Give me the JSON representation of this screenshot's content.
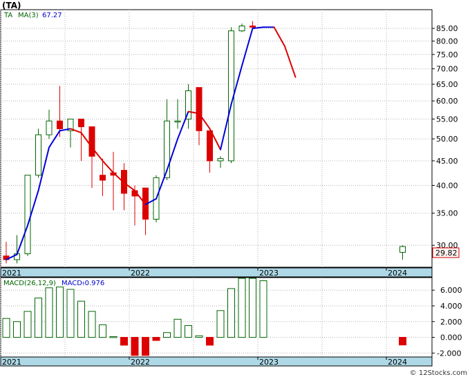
{
  "header": {
    "title": "(TA)"
  },
  "footer": {
    "credit": "© 12Stocks.com"
  },
  "colors": {
    "up": "#006400",
    "down": "#dd0000",
    "ma_up": "#0000dd",
    "ma_down": "#dd0000",
    "axis_band": "#aed8e6",
    "grid": "#b0b0b0"
  },
  "chart_data": [
    {
      "type": "candlestick",
      "scale": "log",
      "legend": {
        "symbol": "TA",
        "ma_label": "MA(3)",
        "ma_value": "67.27",
        "placement": "top-left"
      },
      "ylim": [
        27,
        93
      ],
      "y_ticks": [
        30,
        35,
        40,
        45,
        50,
        55,
        60,
        65,
        70,
        75,
        80,
        85
      ],
      "y_tick_labels": [
        "30.00",
        "35.00",
        "40.00",
        "45.00",
        "50.00",
        "55.00",
        "60.00",
        "65.00",
        "70.00",
        "75.00",
        "80.00",
        "85.00"
      ],
      "last_price": "29.82",
      "x_labels": [
        {
          "label": "2021",
          "index": 0
        },
        {
          "label": "2022",
          "index": 12
        },
        {
          "label": "2023",
          "index": 24
        },
        {
          "label": "2024",
          "index": 36
        }
      ],
      "grid": true,
      "candles": [
        {
          "o": 28.5,
          "h": 30.5,
          "l": 27.5,
          "c": 28.0
        },
        {
          "o": 28.0,
          "h": 31.5,
          "l": 27.5,
          "c": 28.8
        },
        {
          "o": 28.8,
          "h": 42.0,
          "l": 28.5,
          "c": 42.0
        },
        {
          "o": 42.0,
          "h": 52.5,
          "l": 41.5,
          "c": 51.0
        },
        {
          "o": 51.0,
          "h": 57.5,
          "l": 50.0,
          "c": 54.5
        },
        {
          "o": 54.5,
          "h": 64.5,
          "l": 50.5,
          "c": 52.5
        },
        {
          "o": 52.0,
          "h": 55.0,
          "l": 48.0,
          "c": 55.0
        },
        {
          "o": 55.0,
          "h": 55.0,
          "l": 45.0,
          "c": 53.0
        },
        {
          "o": 53.0,
          "h": 53.0,
          "l": 39.5,
          "c": 46.0
        },
        {
          "o": 42.0,
          "h": 45.5,
          "l": 38.0,
          "c": 41.0
        },
        {
          "o": 42.5,
          "h": 47.0,
          "l": 35.5,
          "c": 42.0
        },
        {
          "o": 43.0,
          "h": 44.5,
          "l": 35.5,
          "c": 38.5
        },
        {
          "o": 39.0,
          "h": 40.0,
          "l": 33.0,
          "c": 38.0
        },
        {
          "o": 39.5,
          "h": 39.5,
          "l": 31.5,
          "c": 34.0
        },
        {
          "o": 34.0,
          "h": 42.0,
          "l": 33.5,
          "c": 41.5
        },
        {
          "o": 41.5,
          "h": 60.5,
          "l": 41.0,
          "c": 54.5
        },
        {
          "o": 54.5,
          "h": 60.5,
          "l": 52.5,
          "c": 54.5
        },
        {
          "o": 55.0,
          "h": 65.0,
          "l": 52.5,
          "c": 63.0
        },
        {
          "o": 64.0,
          "h": 64.0,
          "l": 48.5,
          "c": 52.0
        },
        {
          "o": 52.0,
          "h": 52.0,
          "l": 42.5,
          "c": 45.0
        },
        {
          "o": 45.0,
          "h": 46.0,
          "l": 43.5,
          "c": 45.5
        },
        {
          "o": 45.0,
          "h": 85.5,
          "l": 44.5,
          "c": 84.0
        },
        {
          "o": 84.0,
          "h": 87.0,
          "l": 83.5,
          "c": 86.0
        },
        {
          "o": 86.0,
          "h": 88.0,
          "l": 84.5,
          "c": 85.5
        },
        {
          "o": 29.0,
          "h": 30.0,
          "l": 28.0,
          "c": 29.82
        }
      ],
      "candle_x": [
        0,
        1,
        2,
        3,
        4,
        5,
        6,
        7,
        8,
        9,
        10,
        11,
        12,
        13,
        14,
        15,
        16,
        17,
        18,
        19,
        20,
        21,
        22,
        23,
        37
      ],
      "ma": [
        {
          "x": 0,
          "v": 28.0
        },
        {
          "x": 1,
          "v": 28.7
        },
        {
          "x": 2,
          "v": 33.0
        },
        {
          "x": 3,
          "v": 39.0
        },
        {
          "x": 4,
          "v": 48.0
        },
        {
          "x": 5,
          "v": 52.0
        },
        {
          "x": 6,
          "v": 52.5
        },
        {
          "x": 7,
          "v": 51.5
        },
        {
          "x": 8,
          "v": 48.0
        },
        {
          "x": 9,
          "v": 45.0
        },
        {
          "x": 10,
          "v": 42.5
        },
        {
          "x": 11,
          "v": 40.5
        },
        {
          "x": 12,
          "v": 39.0
        },
        {
          "x": 13,
          "v": 36.5
        },
        {
          "x": 14,
          "v": 37.5
        },
        {
          "x": 15,
          "v": 43.0
        },
        {
          "x": 16,
          "v": 50.0
        },
        {
          "x": 17,
          "v": 57.0
        },
        {
          "x": 18,
          "v": 56.5
        },
        {
          "x": 19,
          "v": 52.5
        },
        {
          "x": 20,
          "v": 47.5
        },
        {
          "x": 21,
          "v": 59.0
        },
        {
          "x": 22,
          "v": 71.0
        },
        {
          "x": 23,
          "v": 85.0
        },
        {
          "x": 24,
          "v": 85.5
        },
        {
          "x": 25,
          "v": 85.5
        },
        {
          "x": 26,
          "v": 78.0
        },
        {
          "x": 27,
          "v": 67.27
        }
      ]
    },
    {
      "type": "bar",
      "legend": {
        "label": "MACD(26,12,9)",
        "value_label": "MACD:",
        "value": "-0.976",
        "placement": "top-left"
      },
      "ylim": [
        -2.5,
        7.6
      ],
      "y_ticks": [
        -2,
        0,
        2,
        4,
        6
      ],
      "y_tick_labels": [
        "-2.000",
        "0.000",
        "2.000",
        "4.000",
        "6.000"
      ],
      "x_labels": [
        {
          "label": "2021",
          "index": 0
        },
        {
          "label": "2022",
          "index": 12
        },
        {
          "label": "2023",
          "index": 24
        },
        {
          "label": "2024",
          "index": 36
        }
      ],
      "grid": true,
      "bars": [
        {
          "x": 0,
          "v": 2.4
        },
        {
          "x": 1,
          "v": 2.0
        },
        {
          "x": 2,
          "v": 3.3
        },
        {
          "x": 3,
          "v": 5.0
        },
        {
          "x": 4,
          "v": 6.3
        },
        {
          "x": 5,
          "v": 6.4
        },
        {
          "x": 6,
          "v": 6.1
        },
        {
          "x": 7,
          "v": 4.6
        },
        {
          "x": 8,
          "v": 3.3
        },
        {
          "x": 9,
          "v": 1.6
        },
        {
          "x": 10,
          "v": 0.1
        },
        {
          "x": 11,
          "v": -1.0
        },
        {
          "x": 12,
          "v": -2.3
        },
        {
          "x": 13,
          "v": -2.3
        },
        {
          "x": 14,
          "v": -0.4
        },
        {
          "x": 15,
          "v": 0.6
        },
        {
          "x": 16,
          "v": 2.3
        },
        {
          "x": 17,
          "v": 1.5
        },
        {
          "x": 18,
          "v": 0.2
        },
        {
          "x": 19,
          "v": -1.0
        },
        {
          "x": 20,
          "v": 3.4
        },
        {
          "x": 21,
          "v": 6.2
        },
        {
          "x": 22,
          "v": 7.5
        },
        {
          "x": 23,
          "v": 7.5
        },
        {
          "x": 24,
          "v": 7.2
        },
        {
          "x": 37,
          "v": -0.976
        }
      ]
    }
  ]
}
